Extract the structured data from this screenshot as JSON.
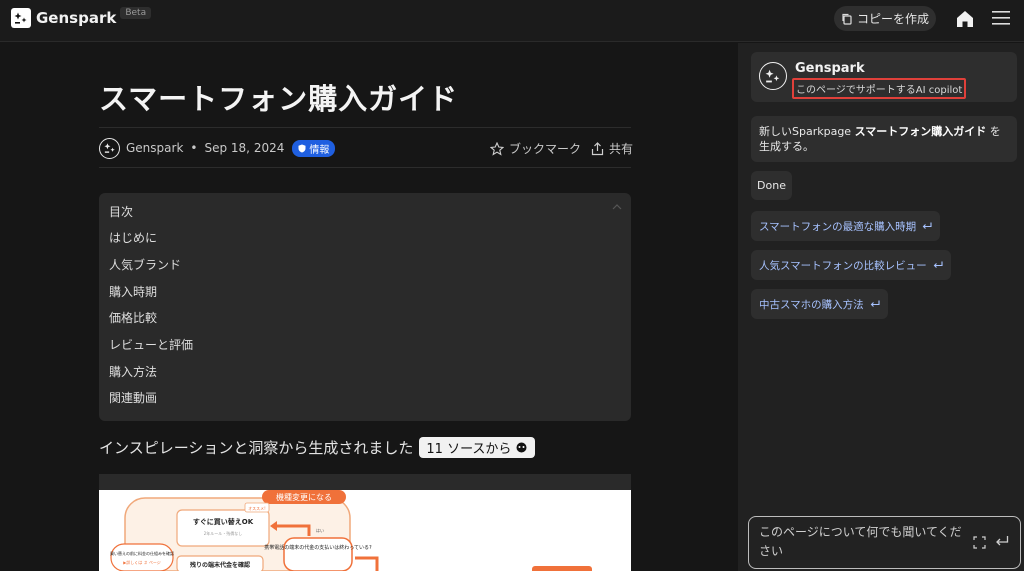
{
  "app": {
    "name": "Genspark",
    "beta": "Beta"
  },
  "header": {
    "copy_button": "コピーを作成"
  },
  "article": {
    "title": "スマートフォン購入ガイド",
    "author": "Genspark",
    "date": "Sep 18, 2024",
    "badge": "情報",
    "bookmark": "ブックマーク",
    "share": "共有",
    "toc": [
      "目次",
      "はじめに",
      "人気ブランド",
      "購入時期",
      "価格比較",
      "レビューと評価",
      "購入方法",
      "関連動画"
    ],
    "generated_text": "インスピレーションと洞察から生成されました",
    "sources_button": "11 ソースから"
  },
  "flowchart": {
    "top": "機種変更になる",
    "box1_title": "すぐに買い替えOK",
    "box1_tag": "オススメ!",
    "box1_body": "2年ルール・残債なし",
    "question": "携帯電話の端末の代金の支払いは終わっている?",
    "yes": "はい",
    "left_note": "買い替えの前に料金の仕組みを確認",
    "left_link": "▶詳しくは ＃ ページ",
    "box2_title": "残りの端末代金を確認"
  },
  "panel": {
    "name": "Genspark",
    "subtitle": "このページでサポートするAI copilot",
    "message_prefix": "新しいSparkpage ",
    "message_bold": "スマートフォン購入ガイド",
    "message_suffix": " を生成する。",
    "done": "Done",
    "suggestions": [
      "スマートフォンの最適な購入時期",
      "人気スマートフォンの比較レビュー",
      "中古スマホの購入方法"
    ],
    "ask_placeholder": "このページについて何でも聞いてください"
  },
  "colors": {
    "accent_badge": "#1f5fe0",
    "highlight_border": "#e0403a",
    "flow_orange": "#f0713a",
    "suggestion": "#a7c2ff"
  }
}
